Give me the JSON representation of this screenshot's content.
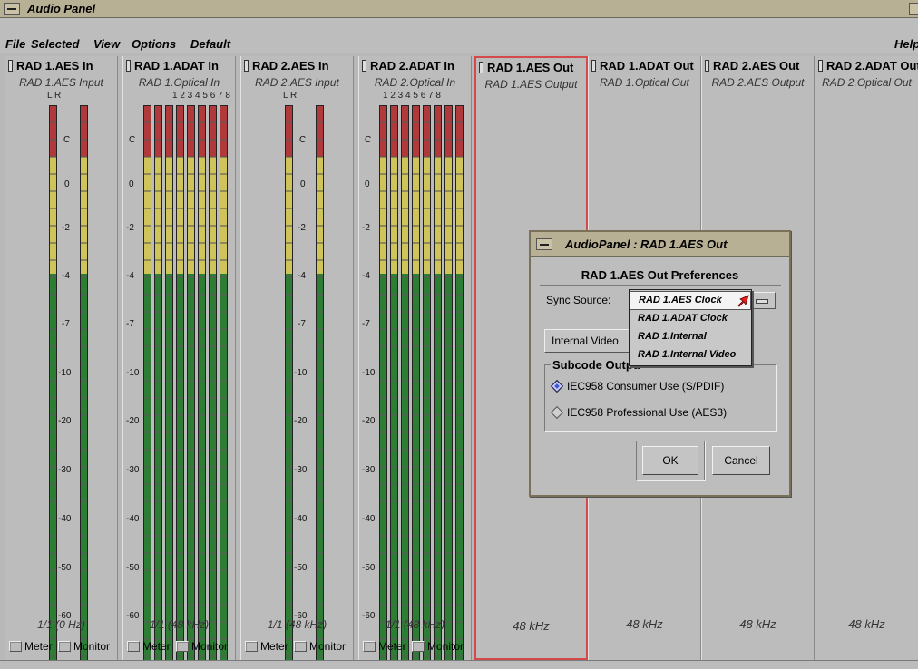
{
  "window": {
    "title": "Audio Panel"
  },
  "menu": {
    "items": [
      "File",
      "Selected",
      "View",
      "Options",
      "Default"
    ],
    "help": "Help"
  },
  "scale_labels": [
    "C",
    "0",
    "-2",
    "-4",
    "-7",
    "-10",
    "-20",
    "-30",
    "-40",
    "-50",
    "-60"
  ],
  "strips": [
    {
      "title": "RAD 1.AES In",
      "subtitle": "RAD 1.AES Input",
      "channels": "L      R",
      "rate": "1/1 (0 Hz)",
      "meter_label": "Meter",
      "monitor_label": "Monitor"
    },
    {
      "title": "RAD 1.ADAT In",
      "subtitle": "RAD 1.Optical In",
      "channels": "1 2 3 4 5 6 7 8",
      "rate": "1/1 (48 kHz)",
      "meter_label": "Meter",
      "monitor_label": "Monitor"
    },
    {
      "title": "RAD 2.AES In",
      "subtitle": "RAD 2.AES Input",
      "channels": "L      R",
      "rate": "1/1 (48 kHz)",
      "meter_label": "Meter",
      "monitor_label": "Monitor"
    },
    {
      "title": "RAD 2.ADAT In",
      "subtitle": "RAD 2.Optical In",
      "channels": "1 2 3 4 5 6 7 8",
      "rate": "1/1 (48 kHz)",
      "meter_label": "Meter",
      "monitor_label": "Monitor"
    },
    {
      "title": "RAD 1.AES Out",
      "subtitle": "RAD 1.AES Output",
      "rate": "48 kHz"
    },
    {
      "title": "RAD 1.ADAT Out",
      "subtitle": "RAD 1.Optical Out",
      "rate": "48 kHz"
    },
    {
      "title": "RAD 2.AES Out",
      "subtitle": "RAD 2.AES Output",
      "rate": "48 kHz"
    },
    {
      "title": "RAD 2.ADAT Out",
      "subtitle": "RAD 2.Optical Out",
      "rate": "48 kHz"
    }
  ],
  "dialog": {
    "title": "AudioPanel : RAD 1.AES Out",
    "heading": "RAD 1.AES Out Preferences",
    "sync_label": "Sync Source:",
    "internal_video_button": "Internal Video",
    "subcode_legend": "Subcode Output",
    "radio_consumer": "IEC958 Consumer Use (S/PDIF)",
    "radio_professional": "IEC958 Professional Use (AES3)",
    "ok": "OK",
    "cancel": "Cancel"
  },
  "sync_options": [
    "RAD 1.AES Clock",
    "RAD 1.ADAT Clock",
    "RAD 1.Internal",
    "RAD 1.Internal Video"
  ],
  "colors": {
    "selected_strip_border": "#d44a4a",
    "meter_red": "#b0393b",
    "meter_yellow": "#cfc45a",
    "meter_green": "#2d7d35"
  }
}
